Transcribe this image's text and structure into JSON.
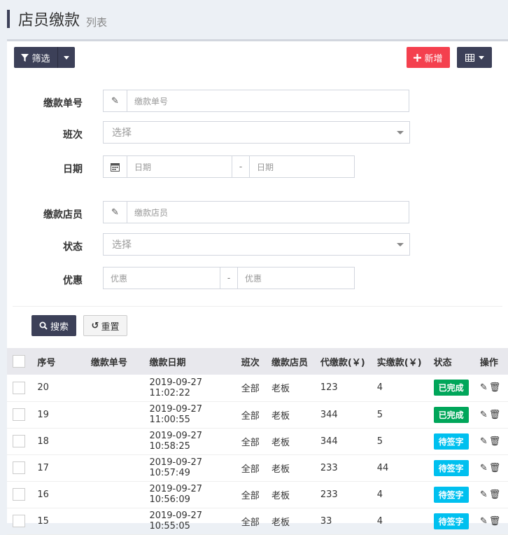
{
  "header": {
    "title": "店员缴款",
    "subtitle": "列表"
  },
  "toolbar": {
    "filter_label": "筛选",
    "add_label": "新增"
  },
  "form": {
    "payment_no": {
      "label": "缴款单号",
      "placeholder": "缴款单号"
    },
    "shift": {
      "label": "班次",
      "value": "选择"
    },
    "date": {
      "label": "日期",
      "from_placeholder": "日期",
      "to_placeholder": "日期",
      "separator": "-"
    },
    "clerk": {
      "label": "缴款店员",
      "placeholder": "缴款店员"
    },
    "status": {
      "label": "状态",
      "value": "选择"
    },
    "discount": {
      "label": "优惠",
      "from_placeholder": "优惠",
      "to_placeholder": "优惠",
      "separator": "-"
    },
    "search_label": "搜索",
    "reset_label": "重置"
  },
  "table": {
    "columns": [
      "序号",
      "缴款单号",
      "缴款日期",
      "班次",
      "缴款店员",
      "代缴款(￥)",
      "实缴款(￥)",
      "状态",
      "操作"
    ],
    "rows": [
      {
        "seq": "20",
        "no": "",
        "date": "2019-09-27 11:02:22",
        "shift": "全部",
        "clerk": "老板",
        "due": "123",
        "paid": "4",
        "status": "已完成"
      },
      {
        "seq": "19",
        "no": "",
        "date": "2019-09-27 11:00:55",
        "shift": "全部",
        "clerk": "老板",
        "due": "344",
        "paid": "5",
        "status": "已完成"
      },
      {
        "seq": "18",
        "no": "",
        "date": "2019-09-27 10:58:25",
        "shift": "全部",
        "clerk": "老板",
        "due": "344",
        "paid": "5",
        "status": "待签字"
      },
      {
        "seq": "17",
        "no": "",
        "date": "2019-09-27 10:57:49",
        "shift": "全部",
        "clerk": "老板",
        "due": "233",
        "paid": "44",
        "status": "待签字"
      },
      {
        "seq": "16",
        "no": "",
        "date": "2019-09-27 10:56:09",
        "shift": "全部",
        "clerk": "老板",
        "due": "233",
        "paid": "4",
        "status": "待签字"
      },
      {
        "seq": "15",
        "no": "",
        "date": "2019-09-27 10:55:05",
        "shift": "全部",
        "clerk": "老板",
        "due": "33",
        "paid": "4",
        "status": "待签字"
      }
    ]
  },
  "colors": {
    "primary": "#3c4058",
    "danger": "#f4404e",
    "success": "#00a65a",
    "info": "#00c0ef"
  },
  "icons": {
    "filter": "filter-icon",
    "plus": "plus-icon",
    "table": "table-icon",
    "pencil": "pencil-icon",
    "calendar": "calendar-icon",
    "search": "search-icon",
    "reset": "undo-icon",
    "edit": "edit-icon",
    "delete": "trash-icon"
  }
}
